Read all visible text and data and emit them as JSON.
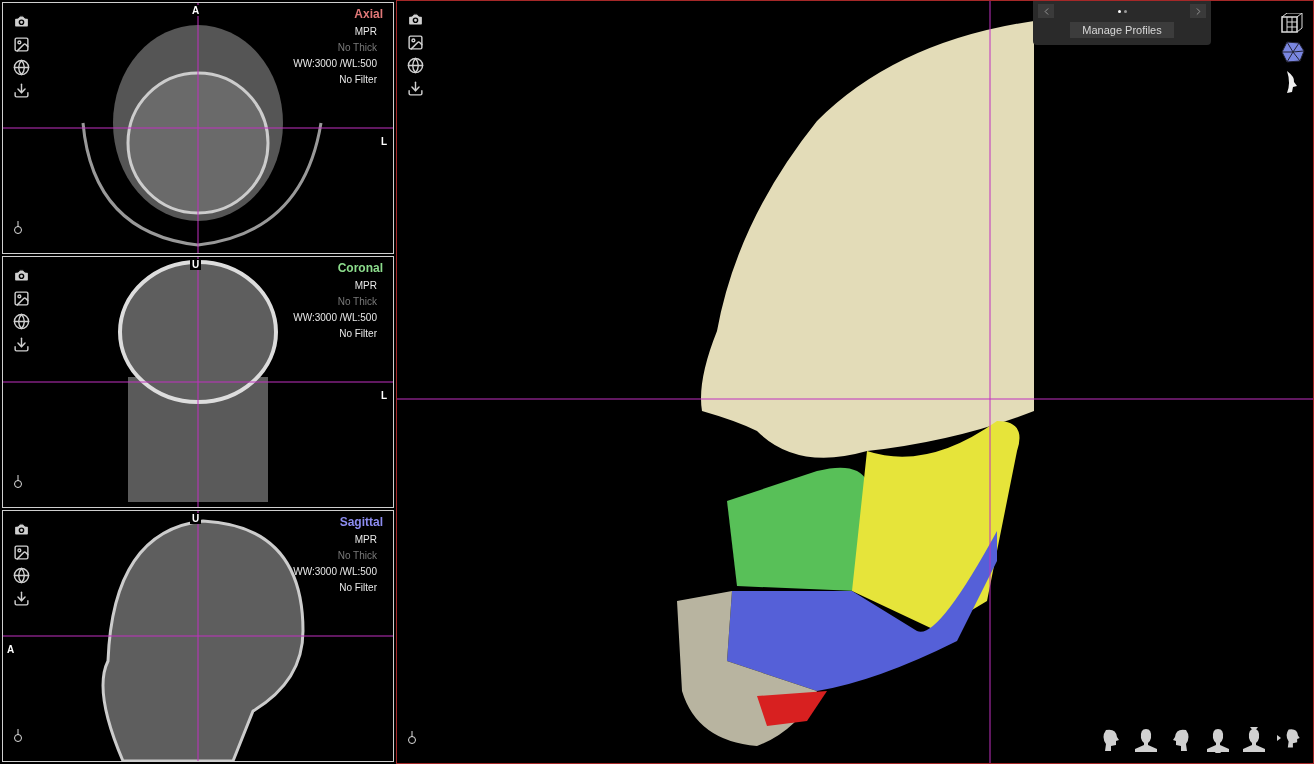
{
  "views": [
    {
      "kind": "axial",
      "title": "Axial",
      "color": "#e07878",
      "lines": [
        {
          "text": "MPR",
          "dim": false
        },
        {
          "text": "No Thick",
          "dim": true
        },
        {
          "text": "WW:3000 /WL:500",
          "dim": false
        },
        {
          "text": "No Filter",
          "dim": false
        }
      ],
      "top_label": "A",
      "side_label": "L"
    },
    {
      "kind": "coronal",
      "title": "Coronal",
      "color": "#8cdc8c",
      "lines": [
        {
          "text": "MPR",
          "dim": false
        },
        {
          "text": "No Thick",
          "dim": true
        },
        {
          "text": "WW:3000 /WL:500",
          "dim": false
        },
        {
          "text": "No Filter",
          "dim": false
        }
      ],
      "top_label": "U",
      "side_label": "L"
    },
    {
      "kind": "sagittal",
      "title": "Sagittal",
      "color": "#8c8cf0",
      "lines": [
        {
          "text": "MPR",
          "dim": false
        },
        {
          "text": "No Thick",
          "dim": true
        },
        {
          "text": "WW:3000 /WL:500",
          "dim": false
        },
        {
          "text": "No Filter",
          "dim": false
        }
      ],
      "top_label": "U",
      "side_label": "A"
    }
  ],
  "profiles": {
    "pages": [
      {
        "selected": true
      },
      {
        "selected": false
      }
    ],
    "button": "Manage Profiles"
  }
}
